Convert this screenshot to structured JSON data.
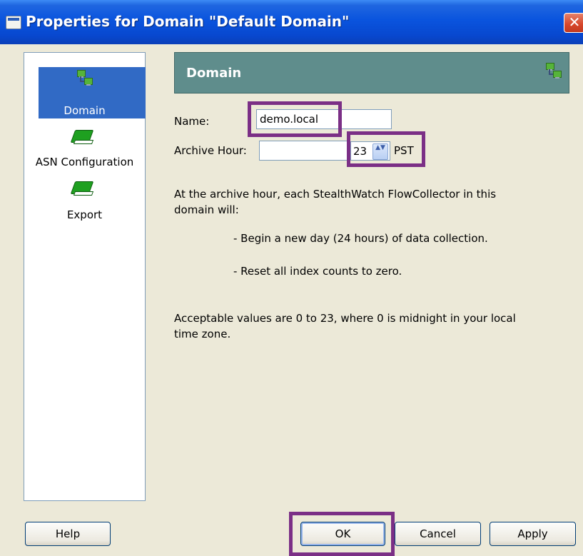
{
  "window": {
    "title": "Properties for Domain \"Default Domain\"",
    "close_glyph": "✕"
  },
  "sidebar": {
    "items": [
      {
        "label": "Domain",
        "icon": "network-icon",
        "selected": true
      },
      {
        "label": "ASN Configuration",
        "icon": "book-icon",
        "selected": false
      },
      {
        "label": "Export",
        "icon": "book-icon",
        "selected": false
      }
    ]
  },
  "panel": {
    "title": "Domain",
    "icon": "network-icon"
  },
  "form": {
    "name_label": "Name:",
    "name_value": "demo.local",
    "archive_label": "Archive Hour:",
    "archive_hour": "23",
    "timezone": "PST",
    "spin_glyph": "▲▼"
  },
  "description": {
    "intro": "At the archive hour, each StealthWatch FlowCollector in this domain will:",
    "bullet1": "- Begin a new day (24 hours) of data collection.",
    "bullet2": "- Reset all index counts to zero.",
    "note": "Acceptable values are 0 to 23, where 0 is midnight in your local time zone."
  },
  "buttons": {
    "help": "Help",
    "ok": "OK",
    "cancel": "Cancel",
    "apply": "Apply"
  },
  "colors": {
    "title_bar": "#0a54de",
    "panel_header": "#5f8d8c",
    "selection": "#316ac5",
    "highlight": "#7b2f86"
  }
}
